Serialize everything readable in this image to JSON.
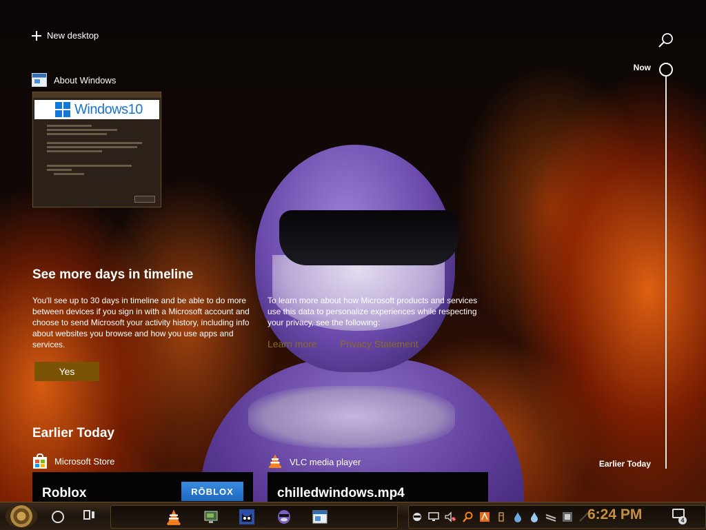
{
  "header": {
    "new_desktop_label": "New desktop"
  },
  "timeline": {
    "now_label": "Now",
    "earlier_label": "Earlier Today"
  },
  "about_windows": {
    "app_name": "About Windows",
    "banner_text": "Windows10"
  },
  "promo": {
    "title": "See more days in timeline",
    "body": "You'll see up to 30 days in timeline and be able to do more between devices if you sign in with a Microsoft account and choose to send Microsoft your activity history, including info about websites you browse and how you use apps and services.",
    "yes_label": "Yes",
    "privacy_body": "To learn more about how Microsoft products and services use this data to personalize experiences while respecting your privacy, see the following:",
    "learn_more_label": "Learn more",
    "privacy_statement_label": "Privacy Statement"
  },
  "earlier_today": {
    "title": "Earlier Today",
    "activities": [
      {
        "app_name": "Microsoft Store",
        "card_title": "Roblox",
        "logo_text": "RŌBLOX"
      },
      {
        "app_name": "VLC media player",
        "card_title": "chilledwindows.mp4"
      }
    ]
  },
  "taskbar": {
    "clock": "6:24 PM",
    "notification_count": "4",
    "pinned_apps": [
      "vlc-icon",
      "monitor-icon",
      "cat-icon",
      "character-icon",
      "about-windows-icon"
    ],
    "tray_icons": [
      "network-icon",
      "volume-muted-icon",
      "search-tool-icon",
      "app-icon",
      "ink-icon",
      "drop-icon",
      "drop-icon-2",
      "stacked-icon",
      "app-tile-icon",
      "pen-icon"
    ]
  },
  "colors": {
    "accent": "#7a5306",
    "link": "#8a6b28",
    "clock": "#c8903a"
  }
}
